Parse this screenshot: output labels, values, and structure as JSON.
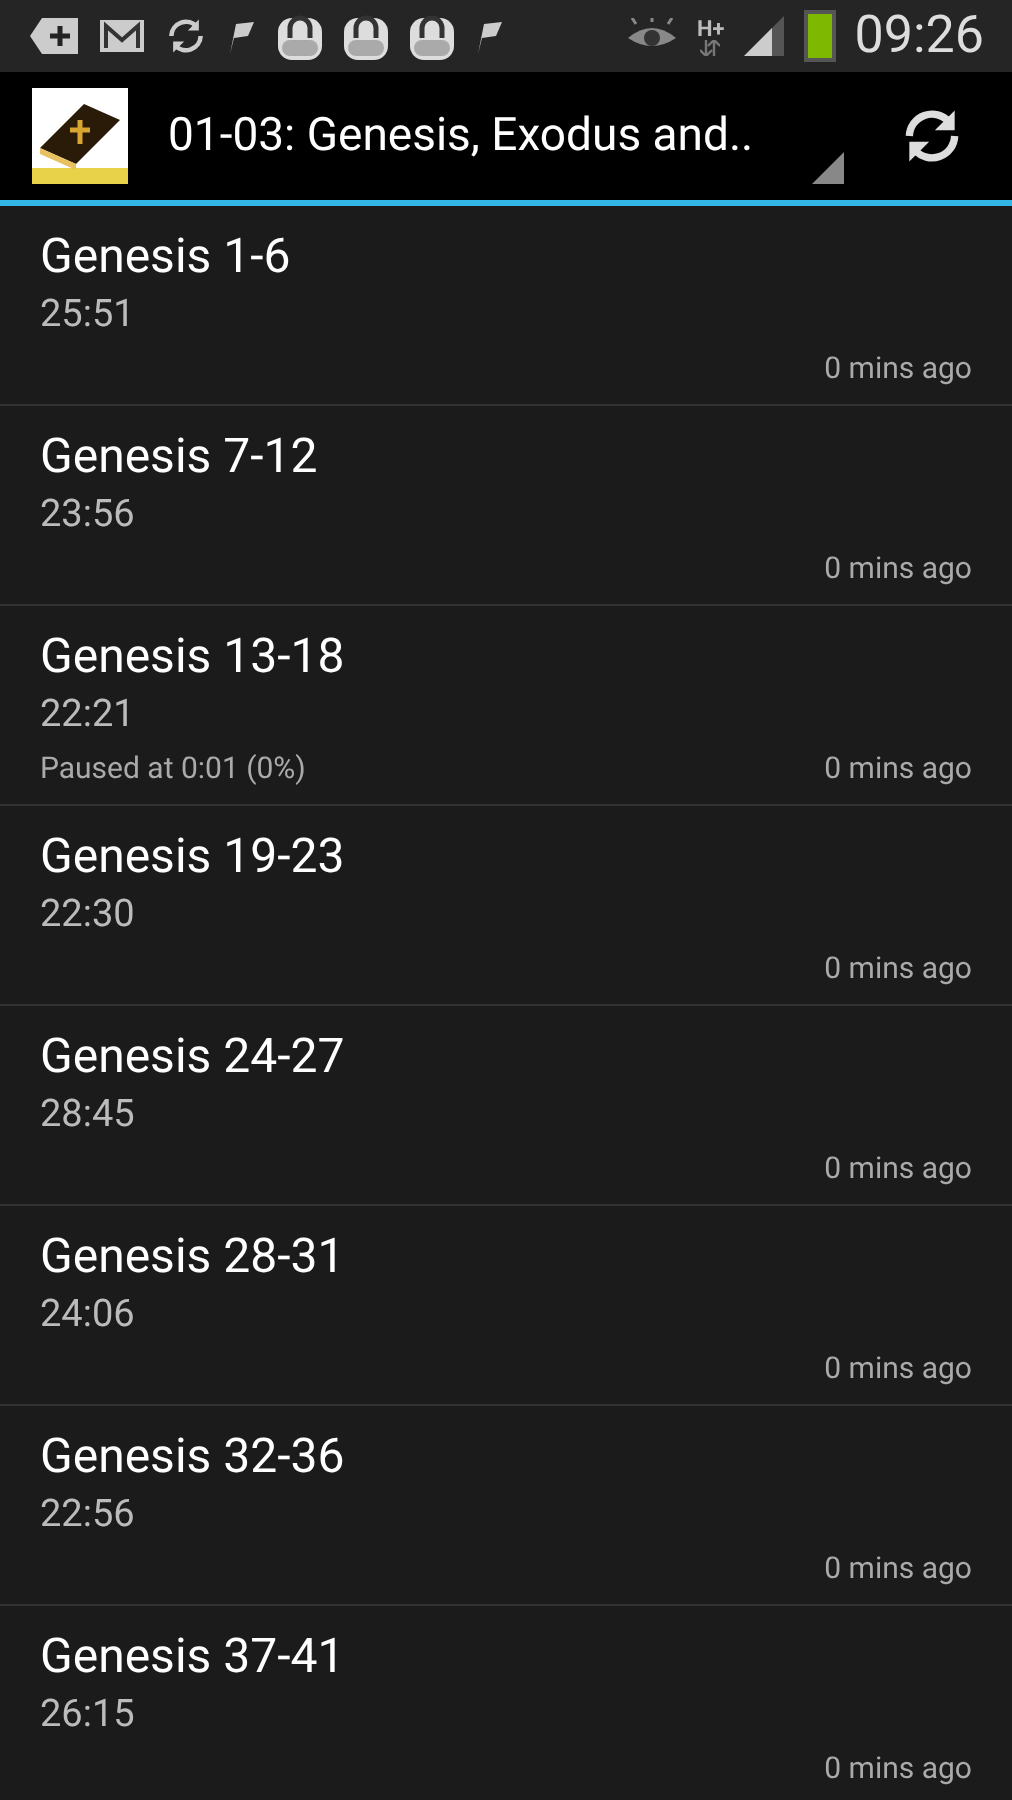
{
  "status_bar": {
    "network_type": "H+",
    "time": "09:26"
  },
  "action_bar": {
    "title": "01-03: Genesis, Exodus and.."
  },
  "episodes": [
    {
      "title": "Genesis 1-6",
      "duration": "25:51",
      "age": "0 mins ago"
    },
    {
      "title": "Genesis 7-12",
      "duration": "23:56",
      "age": "0 mins ago"
    },
    {
      "title": "Genesis 13-18",
      "duration": "22:21",
      "progress": "Paused at 0:01 (0%)",
      "age": "0 mins ago"
    },
    {
      "title": "Genesis 19-23",
      "duration": "22:30",
      "age": "0 mins ago"
    },
    {
      "title": "Genesis 24-27",
      "duration": "28:45",
      "age": "0 mins ago"
    },
    {
      "title": "Genesis 28-31",
      "duration": "24:06",
      "age": "0 mins ago"
    },
    {
      "title": "Genesis 32-36",
      "duration": "22:56",
      "age": "0 mins ago"
    },
    {
      "title": "Genesis 37-41",
      "duration": "26:15",
      "age": "0 mins ago"
    }
  ]
}
